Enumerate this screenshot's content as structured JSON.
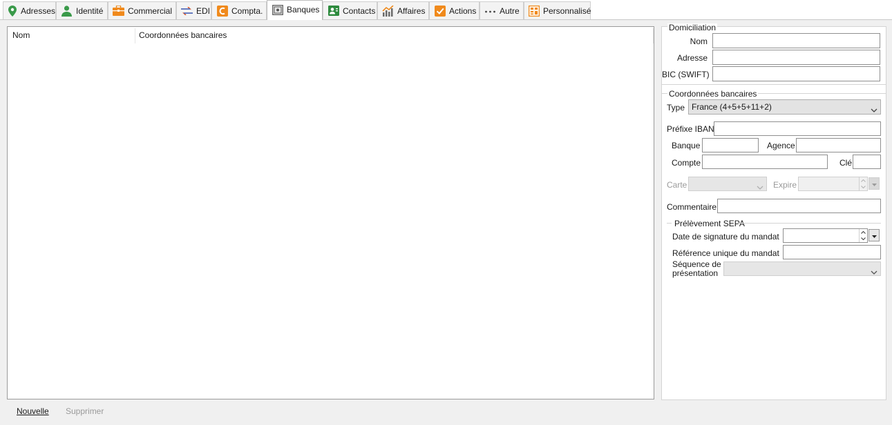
{
  "tabs": [
    {
      "label": "Adresses",
      "icon": "location-pin-icon",
      "active": false
    },
    {
      "label": "Identité",
      "icon": "person-icon",
      "active": false
    },
    {
      "label": "Commercial",
      "icon": "briefcase-icon",
      "active": false
    },
    {
      "label": "EDI",
      "icon": "exchange-arrows-icon",
      "active": false
    },
    {
      "label": "Compta.",
      "icon": "accounting-icon",
      "active": false
    },
    {
      "label": "Banques",
      "icon": "safe-icon",
      "active": true
    },
    {
      "label": "Contacts",
      "icon": "contact-card-icon",
      "active": false
    },
    {
      "label": "Affaires",
      "icon": "bar-chart-icon",
      "active": false
    },
    {
      "label": "Actions",
      "icon": "checkbox-icon",
      "active": false
    },
    {
      "label": "Autre",
      "icon": "ellipsis-icon",
      "active": false
    },
    {
      "label": "Personnalisé",
      "icon": "custom-form-icon",
      "active": false
    }
  ],
  "list": {
    "columns": [
      "Nom",
      "Coordonnées bancaires"
    ],
    "rows": []
  },
  "actions": {
    "new_label": "Nouvelle",
    "delete_label": "Supprimer"
  },
  "domiciliation": {
    "title": "Domiciliation",
    "name_label": "Nom",
    "name_value": "",
    "address_label": "Adresse",
    "address_value": "",
    "bic_label": "BIC (SWIFT)",
    "bic_value": ""
  },
  "bank_details": {
    "title": "Coordonnées bancaires",
    "type_label": "Type",
    "type_value": "France (4+5+5+11+2)",
    "iban_prefix_label": "Préfixe IBAN",
    "iban_prefix_value": "",
    "bank_label": "Banque",
    "bank_value": "",
    "branch_label": "Agence",
    "branch_value": "",
    "account_label": "Compte",
    "account_value": "",
    "key_label": "Clé",
    "key_value": "",
    "card_label": "Carte",
    "card_value": "",
    "expiry_label": "Expire",
    "expiry_value": "",
    "comment_label": "Commentaire",
    "comment_value": ""
  },
  "sepa": {
    "title": "Prélèvement SEPA",
    "signature_date_label": "Date de signature du mandat",
    "signature_date_value": "",
    "mandate_ref_label": "Référence unique du mandat",
    "mandate_ref_value": "",
    "sequence_label_line1": "Séquence de",
    "sequence_label_line2": "présentation",
    "sequence_value": ""
  },
  "colors": {
    "active_tab_bg": "#ffffff",
    "tab_bg": "#f3f3f3",
    "window_bg": "#f0f0f0",
    "pin_green": "#3a9a4a",
    "orange": "#f08a1c",
    "contact_green": "#2e8b3e"
  }
}
